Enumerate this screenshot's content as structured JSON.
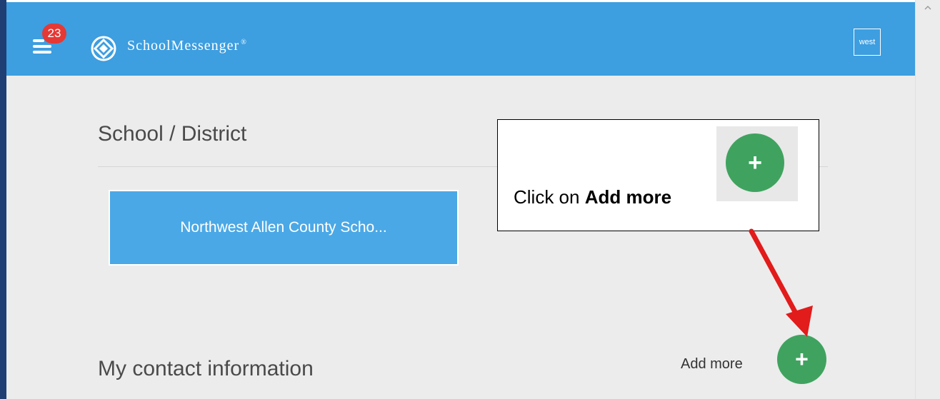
{
  "header": {
    "notification_count": "23",
    "brand_name": "SchoolMessenger",
    "brand_mark": "®",
    "user_label": "west"
  },
  "school_section": {
    "title": "School / District",
    "district_name": "Northwest Allen County Scho..."
  },
  "contact_section": {
    "title": "My contact information",
    "add_more_label": "Add more",
    "add_button_icon": "+"
  },
  "callout": {
    "text_prefix": "Click on ",
    "text_bold": "Add more",
    "thumb_icon": "+"
  },
  "colors": {
    "header_bg": "#3d9ee0",
    "badge": "#e53935",
    "district_card": "#4aa8e6",
    "add_button": "#3fa35f",
    "arrow": "#e21b1b"
  },
  "icons": {
    "menu": "hamburger-menu-icon",
    "logo": "schoolmessenger-logo-icon",
    "add": "plus-icon",
    "scroll": "chevron-up-icon"
  }
}
